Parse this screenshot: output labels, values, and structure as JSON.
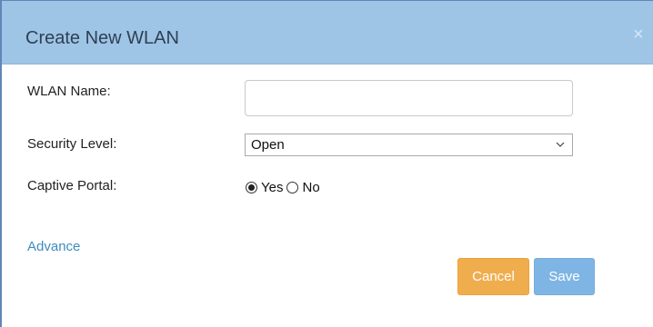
{
  "dialog": {
    "title": "Create New WLAN",
    "close_glyph": "×"
  },
  "form": {
    "wlan_name": {
      "label": "WLAN Name:",
      "value": "",
      "placeholder": ""
    },
    "security_level": {
      "label": "Security Level:",
      "selected": "Open"
    },
    "captive_portal": {
      "label": "Captive Portal:",
      "options": [
        {
          "label": "Yes",
          "checked": true
        },
        {
          "label": "No",
          "checked": false
        }
      ]
    }
  },
  "advance_link": "Advance",
  "buttons": {
    "cancel": "Cancel",
    "save": "Save"
  },
  "colors": {
    "header_bg": "#9ec5e6",
    "cancel_bg": "#f0ad4e",
    "save_bg": "#7fb5e4",
    "link": "#3c8dbc"
  },
  "icons": {
    "close": "close-icon",
    "dropdown": "chevron-down-icon"
  }
}
